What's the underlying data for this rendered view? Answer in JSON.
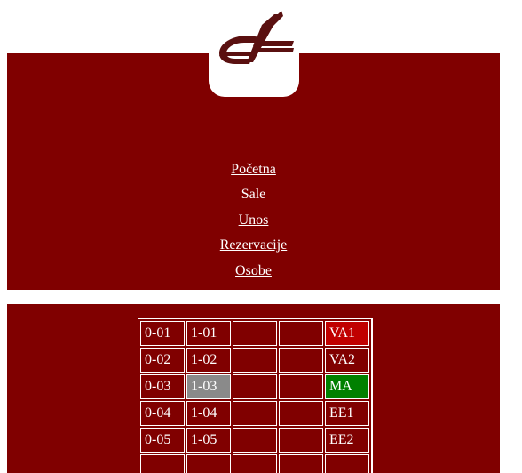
{
  "colors": {
    "brand": "#800000",
    "accent_red": "#c00000",
    "accent_green": "#008000",
    "neutral_gray": "#8a8a8a"
  },
  "nav": {
    "items": [
      {
        "label": "Početna",
        "current": false
      },
      {
        "label": "Sale",
        "current": true
      },
      {
        "label": "Unos",
        "current": false
      },
      {
        "label": "Rezervacije",
        "current": false
      },
      {
        "label": "Osobe",
        "current": false
      }
    ]
  },
  "grid": {
    "rows": [
      [
        {
          "text": "0-01"
        },
        {
          "text": "1-01"
        },
        {
          "text": ""
        },
        {
          "text": ""
        },
        {
          "text": "VA1",
          "status": "red"
        }
      ],
      [
        {
          "text": "0-02"
        },
        {
          "text": "1-02"
        },
        {
          "text": ""
        },
        {
          "text": ""
        },
        {
          "text": "VA2"
        }
      ],
      [
        {
          "text": "0-03"
        },
        {
          "text": "1-03",
          "status": "gray"
        },
        {
          "text": ""
        },
        {
          "text": ""
        },
        {
          "text": "MA",
          "status": "green"
        }
      ],
      [
        {
          "text": "0-04"
        },
        {
          "text": "1-04"
        },
        {
          "text": ""
        },
        {
          "text": ""
        },
        {
          "text": "EE1"
        }
      ],
      [
        {
          "text": "0-05"
        },
        {
          "text": "1-05"
        },
        {
          "text": ""
        },
        {
          "text": ""
        },
        {
          "text": "EE2"
        }
      ],
      [
        {
          "text": ""
        },
        {
          "text": ""
        },
        {
          "text": ""
        },
        {
          "text": ""
        },
        {
          "text": ""
        }
      ]
    ]
  }
}
